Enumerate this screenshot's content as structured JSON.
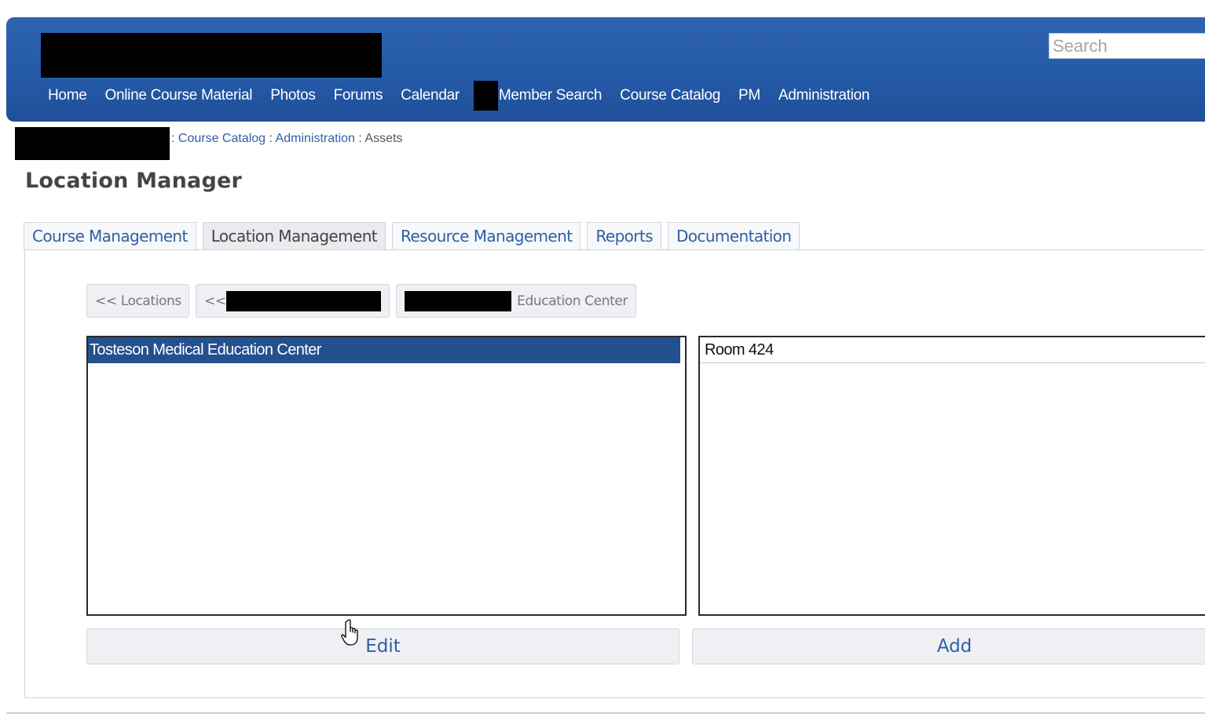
{
  "header": {
    "search_placeholder": "Search",
    "nav": [
      {
        "label": "Home"
      },
      {
        "label": "Online Course Material"
      },
      {
        "label": "Photos"
      },
      {
        "label": "Forums"
      },
      {
        "label": "Calendar"
      },
      {
        "label": "Member Search"
      },
      {
        "label": "Course Catalog"
      },
      {
        "label": "PM"
      },
      {
        "label": "Administration"
      }
    ],
    "colors": {
      "banner": "#2459a7",
      "nav_text": "#ffffff"
    }
  },
  "breadcrumb": {
    "separator": ":",
    "items": [
      {
        "label": "Course Catalog"
      },
      {
        "label": "Administration"
      },
      {
        "label": "Assets"
      }
    ]
  },
  "page": {
    "title": "Location Manager"
  },
  "tabs": [
    {
      "label": "Course Management",
      "active": false
    },
    {
      "label": "Location Management",
      "active": true
    },
    {
      "label": "Resource Management",
      "active": false
    },
    {
      "label": "Reports",
      "active": false
    },
    {
      "label": "Documentation",
      "active": false
    }
  ],
  "location_nav": {
    "back_locations": "<< Locations",
    "back_parent_prefix": "<<",
    "current_suffix": "Education Center"
  },
  "buildings_list": {
    "items": [
      {
        "label": "Tosteson Medical Education Center",
        "selected": true
      }
    ]
  },
  "rooms_list": {
    "items": [
      {
        "label": "Room 424",
        "selected": false
      }
    ]
  },
  "actions": {
    "edit_label": "Edit",
    "add_label": "Add"
  },
  "icons": {
    "cursor": "hand-pointer-icon"
  }
}
